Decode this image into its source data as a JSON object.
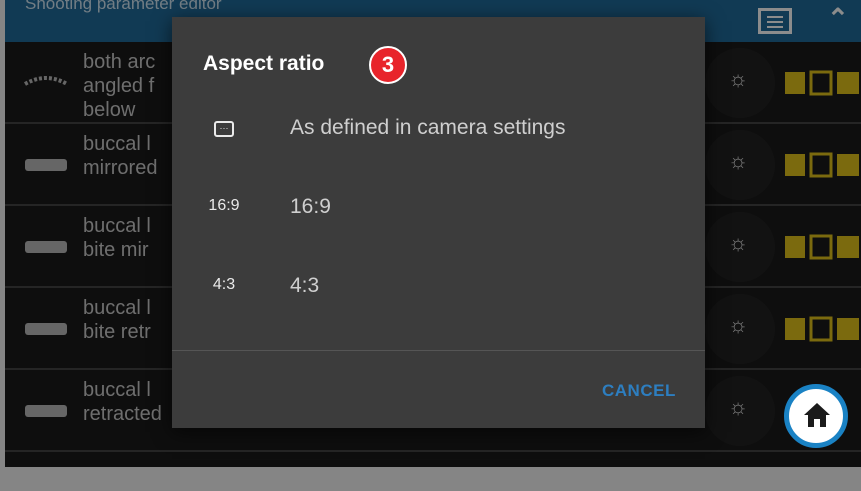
{
  "topbar": {
    "title": "Shooting parameter editor",
    "menu_icon": "menu-icon",
    "collapse_icon": "chevron-up-icon"
  },
  "rows": [
    {
      "label": "both arc\nangled f\nbelow"
    },
    {
      "label": "buccal l\nmirrored"
    },
    {
      "label": "buccal l\nbite mir"
    },
    {
      "label": "buccal l\nbite retr"
    },
    {
      "label": "buccal l\nretracted"
    }
  ],
  "dialog": {
    "title": "Aspect ratio",
    "badge": "3",
    "options": [
      {
        "icon": "card-icon",
        "icon_text": "",
        "text": "As defined in camera settings"
      },
      {
        "icon": "16-9-icon",
        "icon_text": "16:9",
        "text": "16:9"
      },
      {
        "icon": "4-3-icon",
        "icon_text": "4:3",
        "text": "4:3"
      }
    ],
    "cancel_label": "CANCEL"
  },
  "colors": {
    "accent": "#1f6a99",
    "badge": "#e8242b",
    "cancel": "#2d7ec0",
    "home_border": "#1a82c4",
    "indicator": "#e0c11b"
  }
}
